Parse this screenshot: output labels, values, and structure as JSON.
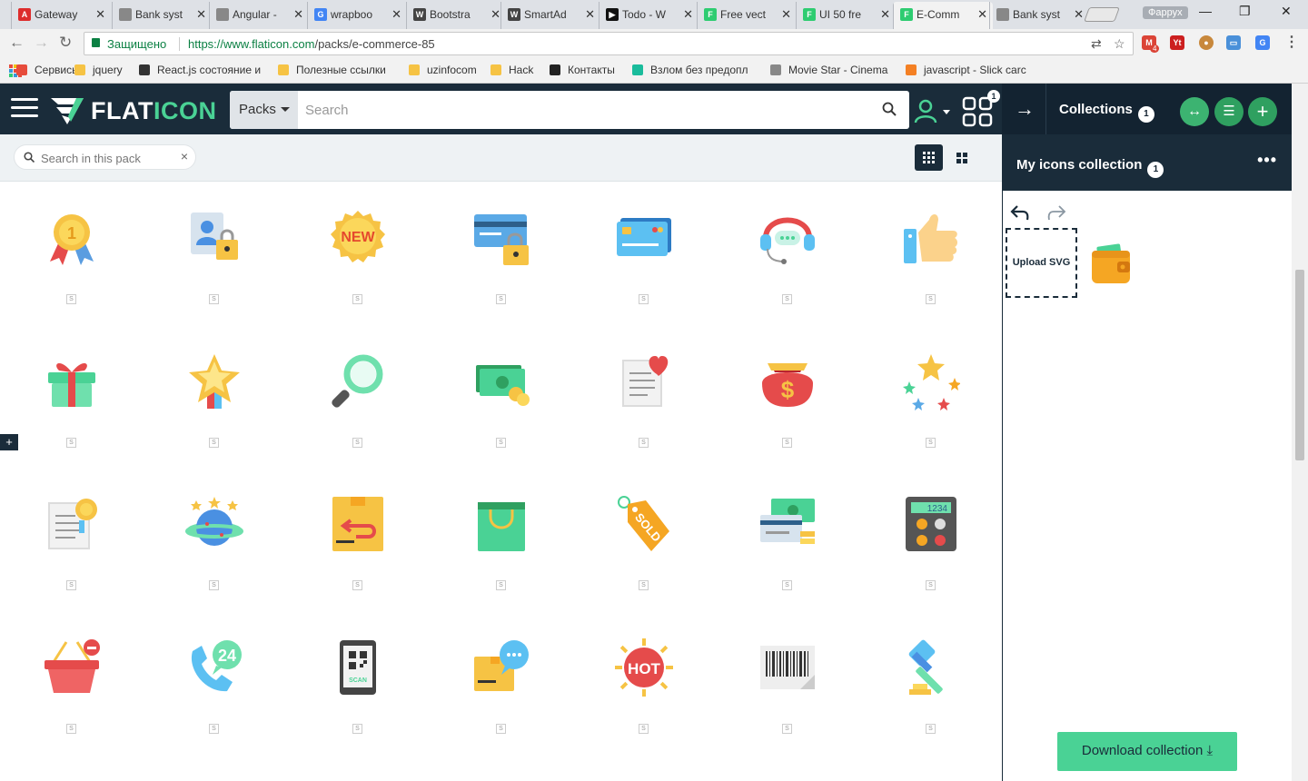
{
  "browser": {
    "tabs": [
      {
        "label": "Gateway",
        "color": "#dd2c2c",
        "glyph": "A"
      },
      {
        "label": "Bank syst",
        "color": "#888888",
        "glyph": ""
      },
      {
        "label": "Angular -",
        "color": "#888888",
        "glyph": ""
      },
      {
        "label": "wrapboo",
        "color": "#4285f4",
        "glyph": "G"
      },
      {
        "label": "Bootstra",
        "color": "#444444",
        "glyph": "W"
      },
      {
        "label": "SmartAd",
        "color": "#444444",
        "glyph": "W"
      },
      {
        "label": "Todo - W",
        "color": "#111111",
        "glyph": "▶"
      },
      {
        "label": "Free vect",
        "color": "#2ecc71",
        "glyph": "F"
      },
      {
        "label": "UI 50 fre",
        "color": "#2ecc71",
        "glyph": "F"
      },
      {
        "label": "E-Comm",
        "color": "#2ecc71",
        "glyph": "F"
      },
      {
        "label": "Bank syst",
        "color": "#888888",
        "glyph": ""
      }
    ],
    "profile": "Фаррух",
    "secure_label": "Защищено",
    "url_host": "https://www.flaticon.com",
    "url_path": "/packs/e-commerce-85",
    "bookmarks": [
      {
        "label": "Сервисы",
        "color": "#e74c3c"
      },
      {
        "label": "jquery",
        "color": "#f6c344"
      },
      {
        "label": "React.js состояние и",
        "color": "#333333"
      },
      {
        "label": "Полезные ссылки",
        "color": "#f6c344"
      },
      {
        "label": "uzinfocom",
        "color": "#f6c344"
      },
      {
        "label": "Hack",
        "color": "#f6c344"
      },
      {
        "label": "Контакты",
        "color": "#222222"
      },
      {
        "label": "Взлом без предопл",
        "color": "#1abc9c"
      },
      {
        "label": "Movie Star - Cinema",
        "color": "#888888"
      },
      {
        "label": "javascript - Slick carc",
        "color": "#f48024"
      }
    ],
    "gmail_badge": "4"
  },
  "header": {
    "logo_prefix": "FLAT",
    "logo_suffix": "ICON",
    "packs_label": "Packs",
    "search_placeholder": "Search",
    "grid_badge": "1"
  },
  "subbar": {
    "pack_search_placeholder": "Search in this pack",
    "clear": "×"
  },
  "icons": [
    "medal",
    "user-lock",
    "new-badge",
    "card-lock",
    "credit-card",
    "headset",
    "thumbs-up",
    "gift",
    "star-ribbon",
    "magnifier",
    "money",
    "document-heart",
    "money-bag",
    "stars",
    "certificate",
    "globe-stars",
    "return-box",
    "shopping-bag",
    "sold-tag",
    "card-money",
    "calculator",
    "basket-remove",
    "phone-24",
    "qr-phone",
    "chat-box",
    "hot-badge",
    "barcode",
    "gavel"
  ],
  "icon_text": {
    "new": "NEW",
    "sold": "SOLD",
    "hot": "HOT",
    "calc": "1234",
    "scan": "SCAN",
    "h24": "24",
    "s_tag": "S"
  },
  "panel": {
    "collections_label": "Collections",
    "collections_count": "1",
    "my_collection": "My icons collection",
    "my_collection_count": "1",
    "upload_label": "Upload SVG",
    "download_label": "Download collection"
  },
  "colors": {
    "brand_dark": "#1a2c3a",
    "brand_green": "#4ad295"
  }
}
